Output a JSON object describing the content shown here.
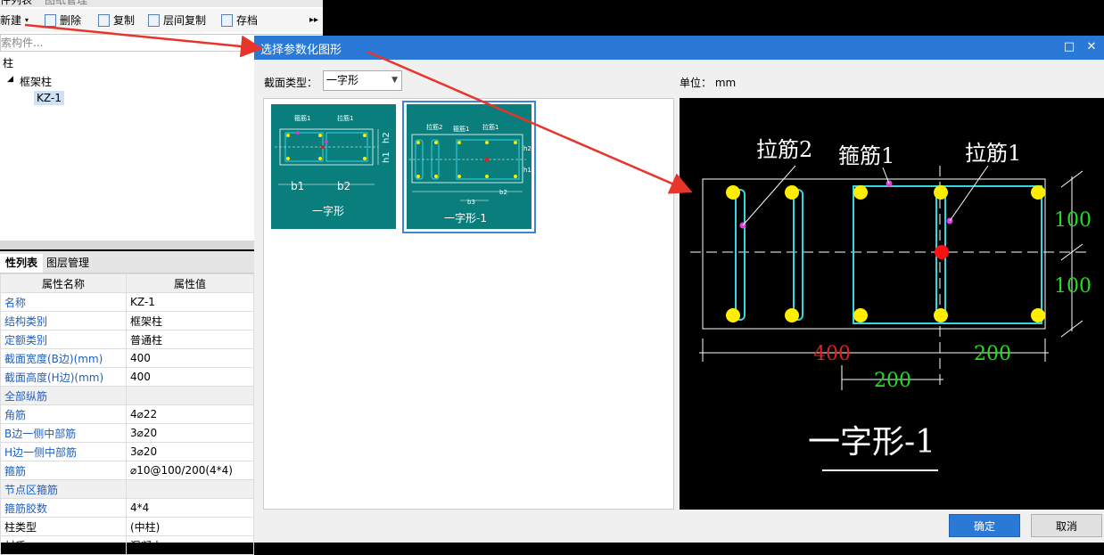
{
  "left_panel": {
    "tabs": [
      "件列表",
      "图纸管理"
    ],
    "toolbar": {
      "new": "新建",
      "delete": "删除",
      "copy": "复制",
      "floor_copy": "层间复制",
      "archive": "存档"
    },
    "search_placeholder": "索构件...",
    "tree": {
      "root": "柱",
      "child": "框架柱",
      "leaf": "KZ-1"
    }
  },
  "props": {
    "tabs": [
      "性列表",
      "图层管理"
    ],
    "headers": [
      "属性名称",
      "属性值"
    ],
    "rows": [
      {
        "name": "名称",
        "value": "KZ-1"
      },
      {
        "name": "结构类别",
        "value": "框架柱"
      },
      {
        "name": "定额类别",
        "value": "普通柱"
      },
      {
        "name": "截面宽度(B边)(mm)",
        "value": "400"
      },
      {
        "name": "截面高度(H边)(mm)",
        "value": "400"
      },
      {
        "name": "全部纵筋",
        "value": ""
      },
      {
        "name": "角筋",
        "value": "4⌀22"
      },
      {
        "name": "B边一侧中部筋",
        "value": "3⌀20"
      },
      {
        "name": "H边一侧中部筋",
        "value": "3⌀20"
      },
      {
        "name": "箍筋",
        "value": "⌀10@100/200(4*4)"
      },
      {
        "name": "节点区箍筋",
        "value": ""
      },
      {
        "name": "箍筋胶数",
        "value": "4*4"
      },
      {
        "name": "柱类型",
        "value": "(中柱)"
      },
      {
        "name": "材质",
        "value": "混凝土"
      }
    ]
  },
  "dialog": {
    "title": "选择参数化图形",
    "section_label": "截面类型：",
    "section_value": "一字形",
    "unit_label": "单位：",
    "unit_value": "mm",
    "thumbs": [
      {
        "caption": "一字形",
        "labels": [
          "箍筋1",
          "拉筋1",
          "b1",
          "b2",
          "h1",
          "h2"
        ]
      },
      {
        "caption": "一字形-1",
        "labels": [
          "拉筋2",
          "箍筋1",
          "拉筋1",
          "b3",
          "b2",
          "h2",
          "h1"
        ]
      }
    ],
    "preview": {
      "labels": {
        "tie2": "拉筋2",
        "stirrup1": "箍筋1",
        "tie1": "拉筋1"
      },
      "dims": {
        "h_top": "100",
        "h_bottom": "100",
        "b_left": "400",
        "b_right": "200",
        "b_mid": "200"
      },
      "caption": "一字形-1"
    },
    "ok": "确定",
    "cancel": "取消"
  },
  "colors": {
    "title_bar": "#2b79d6",
    "thumb_bg": "#0a7e7c",
    "rebar": "#33d6e0",
    "bar_dot": "#ffee00",
    "dim_green": "#22dd22",
    "dim_red": "#e02020",
    "arrow": "#e8342a"
  }
}
